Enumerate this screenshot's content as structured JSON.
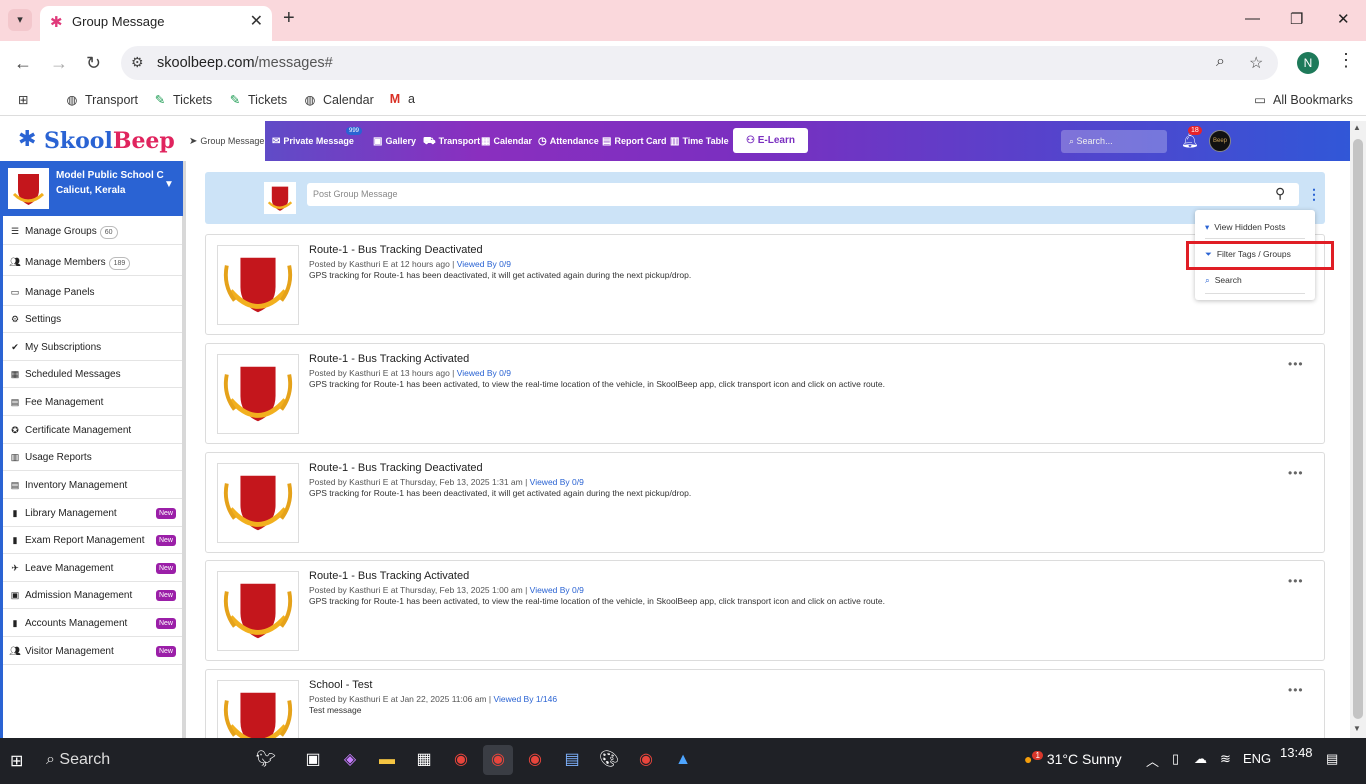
{
  "browser": {
    "tab_title": "Group Message",
    "url_domain": "skoolbeep.com",
    "url_path": "/messages#",
    "profile_initial": "N",
    "bookmarks": [
      "Transport",
      "Tickets",
      "Tickets",
      "Calendar",
      "a"
    ],
    "all_bookmarks": "All Bookmarks"
  },
  "app": {
    "logo_text": "SkoolBeep",
    "nav": [
      "Group Message",
      "Private Message",
      "Gallery",
      "Transport",
      "Calendar",
      "Attendance",
      "Report Card",
      "Time Table"
    ],
    "private_message_badge": "999",
    "elearn_label": "E-Learn",
    "search_placeholder": "Search...",
    "notification_count": "18",
    "avatar_text": "Beep"
  },
  "sidebar": {
    "school_name": "Model Public School C",
    "school_location": "Calicut, Kerala",
    "items": [
      {
        "label": "Manage Groups",
        "count": "60",
        "new": ""
      },
      {
        "label": "Manage Members",
        "count": "189",
        "new": ""
      },
      {
        "label": "Manage Panels",
        "count": "",
        "new": ""
      },
      {
        "label": "Settings",
        "count": "",
        "new": ""
      },
      {
        "label": "My Subscriptions",
        "count": "",
        "new": ""
      },
      {
        "label": "Scheduled Messages",
        "count": "",
        "new": ""
      },
      {
        "label": "Fee Management",
        "count": "",
        "new": ""
      },
      {
        "label": "Certificate Management",
        "count": "",
        "new": ""
      },
      {
        "label": "Usage Reports",
        "count": "",
        "new": ""
      },
      {
        "label": "Inventory Management",
        "count": "",
        "new": ""
      },
      {
        "label": "Library Management",
        "count": "",
        "new": "New"
      },
      {
        "label": "Exam Report Management",
        "count": "",
        "new": "New"
      },
      {
        "label": "Leave Management",
        "count": "",
        "new": "New"
      },
      {
        "label": "Admission Management",
        "count": "",
        "new": "New"
      },
      {
        "label": "Accounts Management",
        "count": "",
        "new": "New"
      },
      {
        "label": "Visitor Management",
        "count": "",
        "new": "New"
      }
    ]
  },
  "main": {
    "post_placeholder": "Post Group Message",
    "posts": [
      {
        "title": "Route-1 - Bus Tracking Deactivated",
        "meta": "Posted by Kasthuri E at 12 hours ago",
        "viewed": "Viewed By 0/9",
        "body": "GPS tracking for Route-1 has been deactivated, it will get activated again during the next pickup/drop."
      },
      {
        "title": "Route-1 - Bus Tracking Activated",
        "meta": "Posted by Kasthuri E at 13 hours ago",
        "viewed": "Viewed By 0/9",
        "body": "GPS tracking for Route-1 has been activated, to view the real-time location of the vehicle, in SkoolBeep app, click transport icon and click on active route."
      },
      {
        "title": "Route-1 - Bus Tracking Deactivated",
        "meta": "Posted by Kasthuri E at Thursday, Feb 13, 2025 1:31 am",
        "viewed": "Viewed By 0/9",
        "body": "GPS tracking for Route-1 has been deactivated, it will get activated again during the next pickup/drop."
      },
      {
        "title": "Route-1 - Bus Tracking Activated",
        "meta": "Posted by Kasthuri E at Thursday, Feb 13, 2025 1:00 am",
        "viewed": "Viewed By 0/9",
        "body": "GPS tracking for Route-1 has been activated, to view the real-time location of the vehicle, in SkoolBeep app, click transport icon and click on active route."
      },
      {
        "title": "School - Test",
        "meta": "Posted by Kasthuri E at Jan 22, 2025 11:06 am",
        "viewed": "Viewed By 1/146",
        "body": "Test message"
      }
    ],
    "menu": [
      "View Hidden Posts",
      "Filter Tags / Groups",
      "Search"
    ]
  },
  "taskbar": {
    "search_label": "Search",
    "weather": "31°C  Sunny",
    "weather_badge": "1",
    "lang": "ENG",
    "time": "13:48"
  }
}
